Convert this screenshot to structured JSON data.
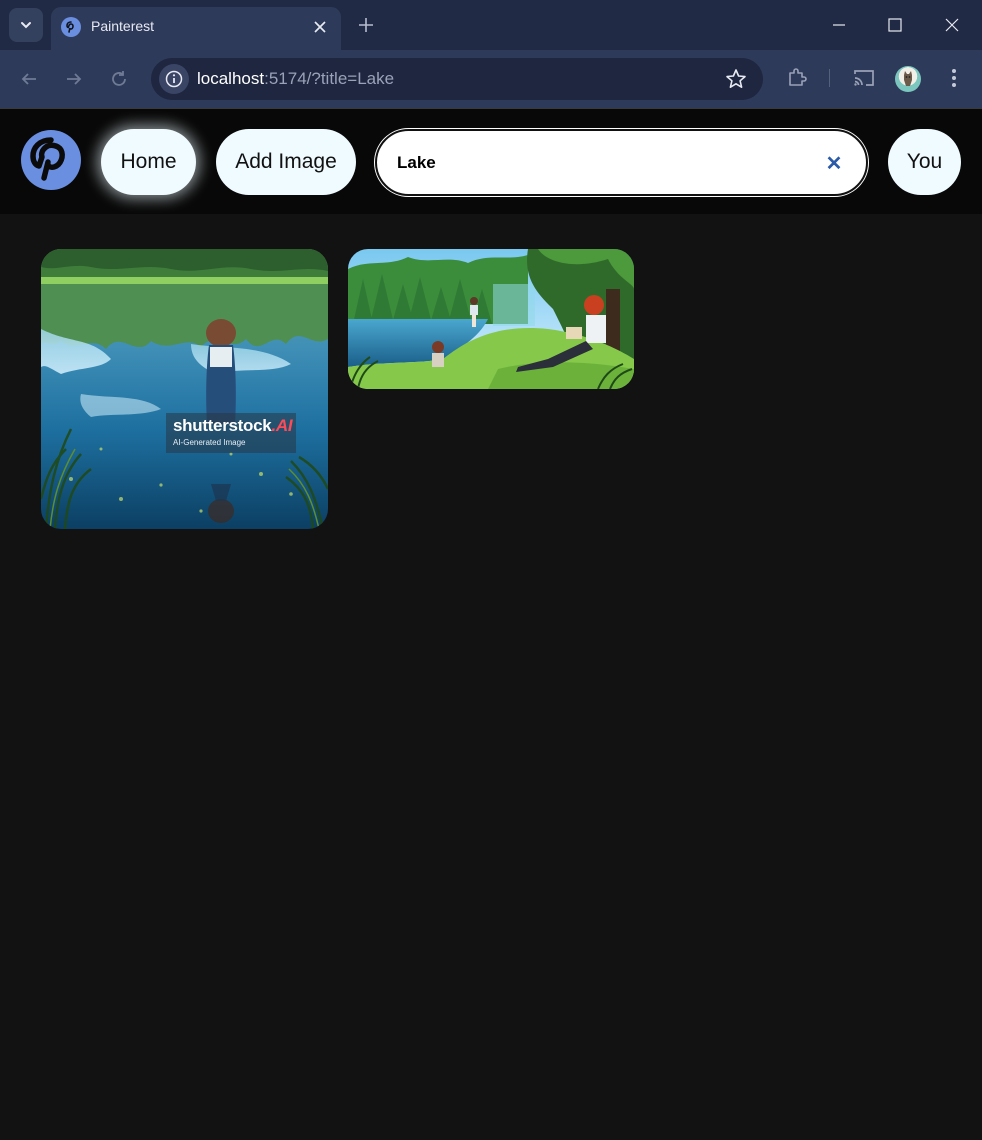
{
  "browser": {
    "tab_title": "Painterest",
    "url_host": "localhost",
    "url_rest": ":5174/?title=Lake",
    "icons": [
      "tab-search-icon",
      "close-icon",
      "plus-icon",
      "minimize-icon",
      "maximize-icon",
      "close-window-icon",
      "back-icon",
      "forward-icon",
      "reload-icon",
      "info-icon",
      "star-icon",
      "extensions-icon",
      "cast-icon",
      "menu-icon"
    ]
  },
  "header": {
    "home_label": "Home",
    "add_image_label": "Add Image",
    "search_value": "Lake",
    "clear_symbol": "✕",
    "profile_label": "You"
  },
  "gallery": {
    "images": [
      {
        "alt": "Anime child standing in a lake reflecting the forest",
        "watermark": {
          "brand": "shutterstock",
          "suffix": ".AI",
          "subtitle": "AI-Generated Image"
        }
      },
      {
        "alt": "Anime boy reading under a tree beside a lake"
      }
    ]
  },
  "colors": {
    "app_background": "#121212",
    "header_background": "#080808",
    "pill_background": "#f0fbff",
    "logo_blue": "#6b8fe0",
    "browser_frame": "#202a44",
    "browser_toolbar": "#2e3a59"
  }
}
